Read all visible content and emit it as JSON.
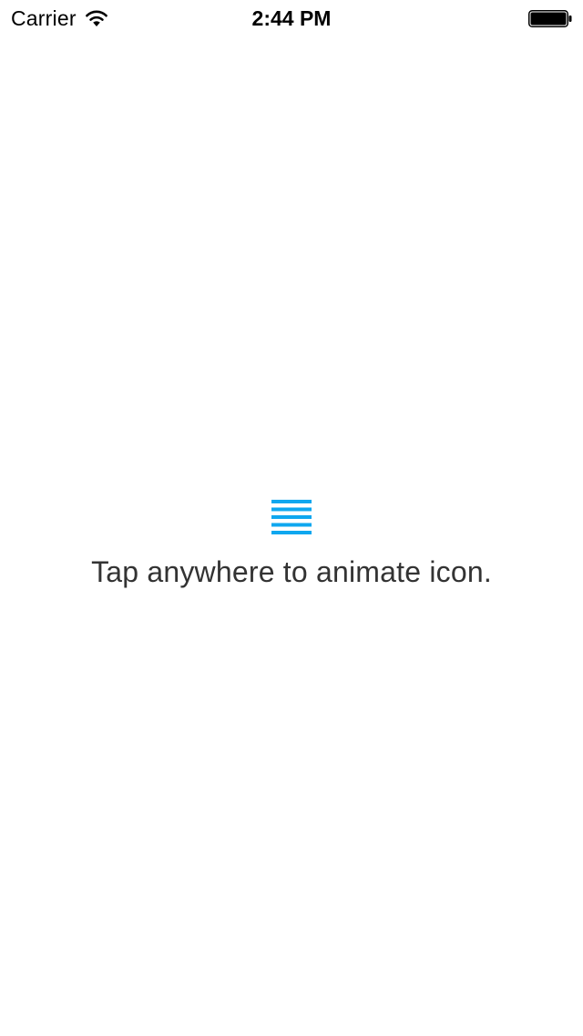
{
  "status_bar": {
    "carrier": "Carrier",
    "time": "2:44 PM",
    "wifi_icon": "wifi-icon",
    "battery_icon": "battery-icon",
    "battery_level": 1.0
  },
  "main": {
    "icon": "hamburger-menu-icon",
    "icon_color": "#0fa7ef",
    "hint": "Tap anywhere to animate icon."
  },
  "colors": {
    "background": "#ffffff",
    "text": "#333333"
  }
}
